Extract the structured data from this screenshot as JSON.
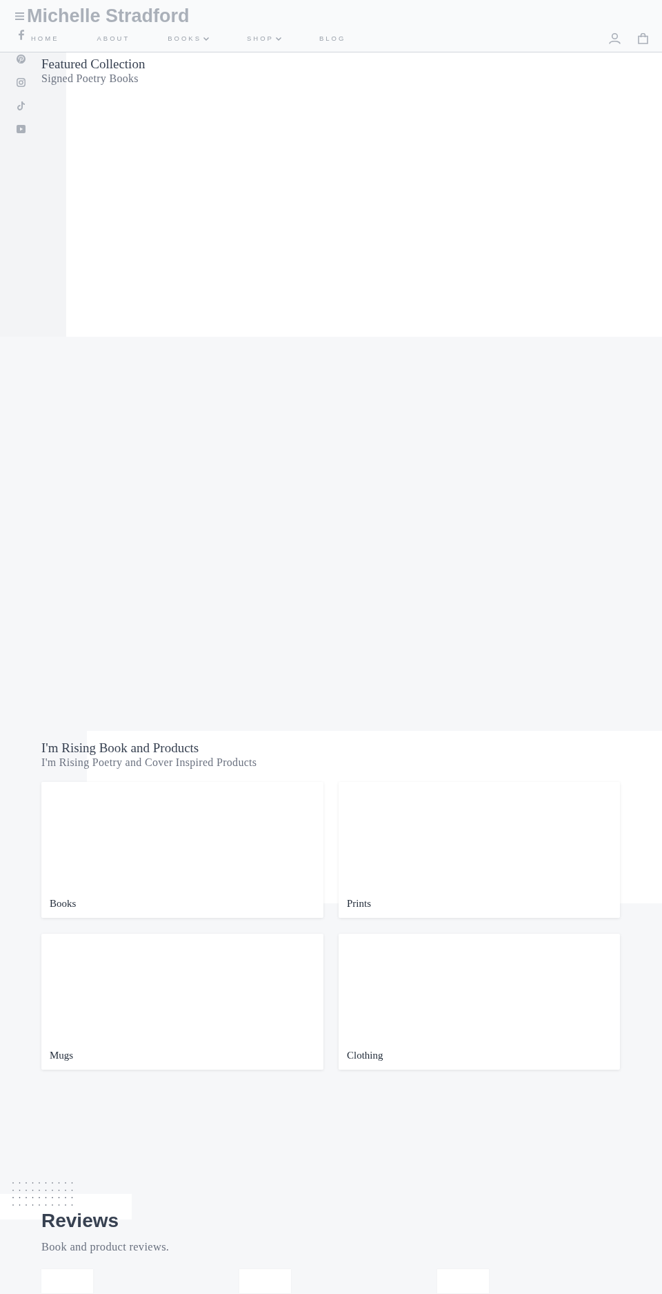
{
  "header": {
    "logo": "Michelle Stradford",
    "nav": [
      {
        "label": "HOME",
        "dropdown": false
      },
      {
        "label": "ABOUT",
        "dropdown": false
      },
      {
        "label": "BOOKS",
        "dropdown": true
      },
      {
        "label": "SHOP",
        "dropdown": true
      },
      {
        "label": "BLOG",
        "dropdown": false
      }
    ]
  },
  "featured": {
    "title": "Featured Collection",
    "subtitle": "Signed Poetry Books"
  },
  "products": {
    "title": "I'm Rising Book and Products",
    "subtitle": "I'm Rising Poetry and Cover Inspired Products",
    "categories": [
      {
        "label": "Books"
      },
      {
        "label": "Prints"
      },
      {
        "label": "Mugs"
      },
      {
        "label": "Clothing"
      }
    ]
  },
  "reviews": {
    "title": "Reviews",
    "subtitle": "Book and product reviews."
  }
}
